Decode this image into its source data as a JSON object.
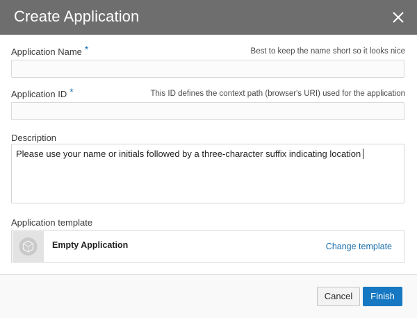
{
  "dialog": {
    "title": "Create Application",
    "close_icon": "close-icon"
  },
  "fields": {
    "app_name": {
      "label": "Application Name",
      "required_marker": "*",
      "hint": "Best to keep the name short so it looks nice",
      "value": ""
    },
    "app_id": {
      "label": "Application ID",
      "required_marker": "*",
      "hint": "This ID defines the context path (browser's URI) used for the application",
      "value": ""
    },
    "description": {
      "label": "Description",
      "value": "Please use your name or initials followed by a three-character suffix indicating location"
    }
  },
  "template": {
    "label": "Application template",
    "name": "Empty Application",
    "change_label": "Change template",
    "thumbnail_icon": "empty-template-icon"
  },
  "footer": {
    "cancel_label": "Cancel",
    "finish_label": "Finish"
  },
  "colors": {
    "header_bg": "#6e6e6e",
    "accent": "#1678c2",
    "link": "#1a6fae",
    "required": "#1b75bb"
  }
}
